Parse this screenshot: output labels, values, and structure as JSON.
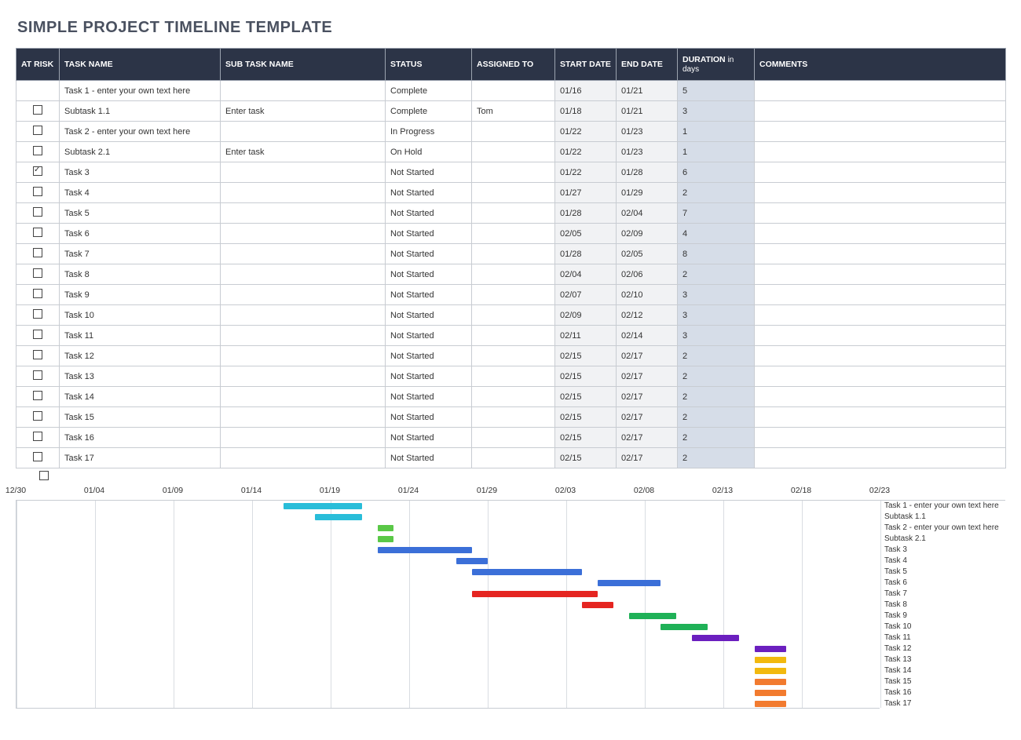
{
  "title": "SIMPLE PROJECT TIMELINE TEMPLATE",
  "columns": {
    "at_risk": "AT RISK",
    "task_name": "TASK NAME",
    "sub_task_name": "SUB TASK NAME",
    "status": "STATUS",
    "assigned_to": "ASSIGNED TO",
    "start_date": "START DATE",
    "end_date": "END DATE",
    "duration": "DURATION",
    "duration_unit": "in days",
    "comments": "COMMENTS"
  },
  "rows": [
    {
      "at_risk": null,
      "task": "Task 1 - enter your own text here",
      "subtask": "",
      "status": "Complete",
      "assigned": "",
      "start": "01/16",
      "end": "01/21",
      "dur": "5",
      "comments": ""
    },
    {
      "at_risk": false,
      "task": "Subtask 1.1",
      "subtask": "Enter task",
      "status": "Complete",
      "assigned": "Tom",
      "start": "01/18",
      "end": "01/21",
      "dur": "3",
      "comments": ""
    },
    {
      "at_risk": false,
      "task": "Task 2 - enter your own text here",
      "subtask": "",
      "status": "In Progress",
      "assigned": "",
      "start": "01/22",
      "end": "01/23",
      "dur": "1",
      "comments": ""
    },
    {
      "at_risk": false,
      "task": "Subtask 2.1",
      "subtask": "Enter task",
      "status": "On Hold",
      "assigned": "",
      "start": "01/22",
      "end": "01/23",
      "dur": "1",
      "comments": ""
    },
    {
      "at_risk": true,
      "task": "Task 3",
      "subtask": "",
      "status": "Not Started",
      "assigned": "",
      "start": "01/22",
      "end": "01/28",
      "dur": "6",
      "comments": ""
    },
    {
      "at_risk": false,
      "task": "Task 4",
      "subtask": "",
      "status": "Not Started",
      "assigned": "",
      "start": "01/27",
      "end": "01/29",
      "dur": "2",
      "comments": ""
    },
    {
      "at_risk": false,
      "task": "Task 5",
      "subtask": "",
      "status": "Not Started",
      "assigned": "",
      "start": "01/28",
      "end": "02/04",
      "dur": "7",
      "comments": ""
    },
    {
      "at_risk": false,
      "task": "Task 6",
      "subtask": "",
      "status": "Not Started",
      "assigned": "",
      "start": "02/05",
      "end": "02/09",
      "dur": "4",
      "comments": ""
    },
    {
      "at_risk": false,
      "task": "Task 7",
      "subtask": "",
      "status": "Not Started",
      "assigned": "",
      "start": "01/28",
      "end": "02/05",
      "dur": "8",
      "comments": ""
    },
    {
      "at_risk": false,
      "task": "Task 8",
      "subtask": "",
      "status": "Not Started",
      "assigned": "",
      "start": "02/04",
      "end": "02/06",
      "dur": "2",
      "comments": ""
    },
    {
      "at_risk": false,
      "task": "Task 9",
      "subtask": "",
      "status": "Not Started",
      "assigned": "",
      "start": "02/07",
      "end": "02/10",
      "dur": "3",
      "comments": ""
    },
    {
      "at_risk": false,
      "task": "Task 10",
      "subtask": "",
      "status": "Not Started",
      "assigned": "",
      "start": "02/09",
      "end": "02/12",
      "dur": "3",
      "comments": ""
    },
    {
      "at_risk": false,
      "task": "Task 11",
      "subtask": "",
      "status": "Not Started",
      "assigned": "",
      "start": "02/11",
      "end": "02/14",
      "dur": "3",
      "comments": ""
    },
    {
      "at_risk": false,
      "task": "Task 12",
      "subtask": "",
      "status": "Not Started",
      "assigned": "",
      "start": "02/15",
      "end": "02/17",
      "dur": "2",
      "comments": ""
    },
    {
      "at_risk": false,
      "task": "Task 13",
      "subtask": "",
      "status": "Not Started",
      "assigned": "",
      "start": "02/15",
      "end": "02/17",
      "dur": "2",
      "comments": ""
    },
    {
      "at_risk": false,
      "task": "Task 14",
      "subtask": "",
      "status": "Not Started",
      "assigned": "",
      "start": "02/15",
      "end": "02/17",
      "dur": "2",
      "comments": ""
    },
    {
      "at_risk": false,
      "task": "Task 15",
      "subtask": "",
      "status": "Not Started",
      "assigned": "",
      "start": "02/15",
      "end": "02/17",
      "dur": "2",
      "comments": ""
    },
    {
      "at_risk": false,
      "task": "Task 16",
      "subtask": "",
      "status": "Not Started",
      "assigned": "",
      "start": "02/15",
      "end": "02/17",
      "dur": "2",
      "comments": ""
    },
    {
      "at_risk": false,
      "task": "Task 17",
      "subtask": "",
      "status": "Not Started",
      "assigned": "",
      "start": "02/15",
      "end": "02/17",
      "dur": "2",
      "comments": ""
    }
  ],
  "extra_checkbox_below": false,
  "chart_data": {
    "type": "bar",
    "orientation": "horizontal-gantt",
    "x_ticks": [
      "12/30",
      "01/04",
      "01/09",
      "01/14",
      "01/19",
      "01/24",
      "01/29",
      "02/03",
      "02/08",
      "02/13",
      "02/18",
      "02/23"
    ],
    "x_start_dayindex": 0,
    "x_end_dayindex": 55,
    "series": [
      {
        "name": "Task 1 - enter your own text here",
        "start": "01/16",
        "end": "01/21",
        "start_day": 17,
        "end_day": 22,
        "color": "#29bdd9"
      },
      {
        "name": "Subtask 1.1",
        "start": "01/18",
        "end": "01/21",
        "start_day": 19,
        "end_day": 22,
        "color": "#29bdd9"
      },
      {
        "name": "Task 2 - enter your own text here",
        "start": "01/22",
        "end": "01/23",
        "start_day": 23,
        "end_day": 24,
        "color": "#5ac847"
      },
      {
        "name": "Subtask 2.1",
        "start": "01/22",
        "end": "01/23",
        "start_day": 23,
        "end_day": 24,
        "color": "#5ac847"
      },
      {
        "name": "Task 3",
        "start": "01/22",
        "end": "01/28",
        "start_day": 23,
        "end_day": 29,
        "color": "#3b6fd8"
      },
      {
        "name": "Task 4",
        "start": "01/27",
        "end": "01/29",
        "start_day": 28,
        "end_day": 30,
        "color": "#3b6fd8"
      },
      {
        "name": "Task 5",
        "start": "01/28",
        "end": "02/04",
        "start_day": 29,
        "end_day": 36,
        "color": "#3b6fd8"
      },
      {
        "name": "Task 6",
        "start": "02/05",
        "end": "02/09",
        "start_day": 37,
        "end_day": 41,
        "color": "#3b6fd8"
      },
      {
        "name": "Task 7",
        "start": "01/28",
        "end": "02/05",
        "start_day": 29,
        "end_day": 37,
        "color": "#e52521"
      },
      {
        "name": "Task 8",
        "start": "02/04",
        "end": "02/06",
        "start_day": 36,
        "end_day": 38,
        "color": "#e52521"
      },
      {
        "name": "Task 9",
        "start": "02/07",
        "end": "02/10",
        "start_day": 39,
        "end_day": 42,
        "color": "#1fb157"
      },
      {
        "name": "Task 10",
        "start": "02/09",
        "end": "02/12",
        "start_day": 41,
        "end_day": 44,
        "color": "#1fb157"
      },
      {
        "name": "Task 11",
        "start": "02/11",
        "end": "02/14",
        "start_day": 43,
        "end_day": 46,
        "color": "#6b1fbf"
      },
      {
        "name": "Task 12",
        "start": "02/15",
        "end": "02/17",
        "start_day": 47,
        "end_day": 49,
        "color": "#6b1fbf"
      },
      {
        "name": "Task 13",
        "start": "02/15",
        "end": "02/17",
        "start_day": 47,
        "end_day": 49,
        "color": "#f2b90f"
      },
      {
        "name": "Task 14",
        "start": "02/15",
        "end": "02/17",
        "start_day": 47,
        "end_day": 49,
        "color": "#f2b90f"
      },
      {
        "name": "Task 15",
        "start": "02/15",
        "end": "02/17",
        "start_day": 47,
        "end_day": 49,
        "color": "#f27b2f"
      },
      {
        "name": "Task 16",
        "start": "02/15",
        "end": "02/17",
        "start_day": 47,
        "end_day": 49,
        "color": "#f27b2f"
      },
      {
        "name": "Task 17",
        "start": "02/15",
        "end": "02/17",
        "start_day": 47,
        "end_day": 49,
        "color": "#f27b2f"
      }
    ]
  }
}
